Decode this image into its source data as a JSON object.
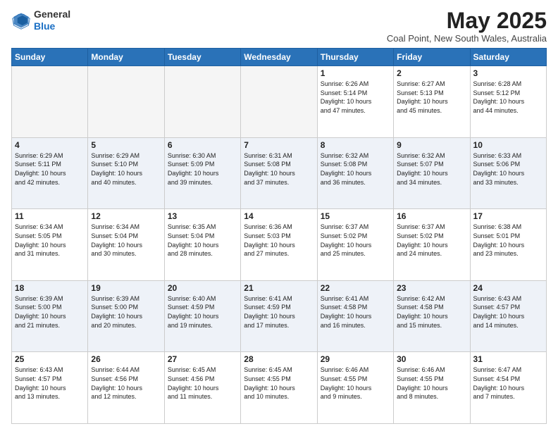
{
  "header": {
    "logo_general": "General",
    "logo_blue": "Blue",
    "month_title": "May 2025",
    "location": "Coal Point, New South Wales, Australia"
  },
  "weekdays": [
    "Sunday",
    "Monday",
    "Tuesday",
    "Wednesday",
    "Thursday",
    "Friday",
    "Saturday"
  ],
  "weeks": [
    [
      {
        "day": "",
        "info": ""
      },
      {
        "day": "",
        "info": ""
      },
      {
        "day": "",
        "info": ""
      },
      {
        "day": "",
        "info": ""
      },
      {
        "day": "1",
        "info": "Sunrise: 6:26 AM\nSunset: 5:14 PM\nDaylight: 10 hours\nand 47 minutes."
      },
      {
        "day": "2",
        "info": "Sunrise: 6:27 AM\nSunset: 5:13 PM\nDaylight: 10 hours\nand 45 minutes."
      },
      {
        "day": "3",
        "info": "Sunrise: 6:28 AM\nSunset: 5:12 PM\nDaylight: 10 hours\nand 44 minutes."
      }
    ],
    [
      {
        "day": "4",
        "info": "Sunrise: 6:29 AM\nSunset: 5:11 PM\nDaylight: 10 hours\nand 42 minutes."
      },
      {
        "day": "5",
        "info": "Sunrise: 6:29 AM\nSunset: 5:10 PM\nDaylight: 10 hours\nand 40 minutes."
      },
      {
        "day": "6",
        "info": "Sunrise: 6:30 AM\nSunset: 5:09 PM\nDaylight: 10 hours\nand 39 minutes."
      },
      {
        "day": "7",
        "info": "Sunrise: 6:31 AM\nSunset: 5:08 PM\nDaylight: 10 hours\nand 37 minutes."
      },
      {
        "day": "8",
        "info": "Sunrise: 6:32 AM\nSunset: 5:08 PM\nDaylight: 10 hours\nand 36 minutes."
      },
      {
        "day": "9",
        "info": "Sunrise: 6:32 AM\nSunset: 5:07 PM\nDaylight: 10 hours\nand 34 minutes."
      },
      {
        "day": "10",
        "info": "Sunrise: 6:33 AM\nSunset: 5:06 PM\nDaylight: 10 hours\nand 33 minutes."
      }
    ],
    [
      {
        "day": "11",
        "info": "Sunrise: 6:34 AM\nSunset: 5:05 PM\nDaylight: 10 hours\nand 31 minutes."
      },
      {
        "day": "12",
        "info": "Sunrise: 6:34 AM\nSunset: 5:04 PM\nDaylight: 10 hours\nand 30 minutes."
      },
      {
        "day": "13",
        "info": "Sunrise: 6:35 AM\nSunset: 5:04 PM\nDaylight: 10 hours\nand 28 minutes."
      },
      {
        "day": "14",
        "info": "Sunrise: 6:36 AM\nSunset: 5:03 PM\nDaylight: 10 hours\nand 27 minutes."
      },
      {
        "day": "15",
        "info": "Sunrise: 6:37 AM\nSunset: 5:02 PM\nDaylight: 10 hours\nand 25 minutes."
      },
      {
        "day": "16",
        "info": "Sunrise: 6:37 AM\nSunset: 5:02 PM\nDaylight: 10 hours\nand 24 minutes."
      },
      {
        "day": "17",
        "info": "Sunrise: 6:38 AM\nSunset: 5:01 PM\nDaylight: 10 hours\nand 23 minutes."
      }
    ],
    [
      {
        "day": "18",
        "info": "Sunrise: 6:39 AM\nSunset: 5:00 PM\nDaylight: 10 hours\nand 21 minutes."
      },
      {
        "day": "19",
        "info": "Sunrise: 6:39 AM\nSunset: 5:00 PM\nDaylight: 10 hours\nand 20 minutes."
      },
      {
        "day": "20",
        "info": "Sunrise: 6:40 AM\nSunset: 4:59 PM\nDaylight: 10 hours\nand 19 minutes."
      },
      {
        "day": "21",
        "info": "Sunrise: 6:41 AM\nSunset: 4:59 PM\nDaylight: 10 hours\nand 17 minutes."
      },
      {
        "day": "22",
        "info": "Sunrise: 6:41 AM\nSunset: 4:58 PM\nDaylight: 10 hours\nand 16 minutes."
      },
      {
        "day": "23",
        "info": "Sunrise: 6:42 AM\nSunset: 4:58 PM\nDaylight: 10 hours\nand 15 minutes."
      },
      {
        "day": "24",
        "info": "Sunrise: 6:43 AM\nSunset: 4:57 PM\nDaylight: 10 hours\nand 14 minutes."
      }
    ],
    [
      {
        "day": "25",
        "info": "Sunrise: 6:43 AM\nSunset: 4:57 PM\nDaylight: 10 hours\nand 13 minutes."
      },
      {
        "day": "26",
        "info": "Sunrise: 6:44 AM\nSunset: 4:56 PM\nDaylight: 10 hours\nand 12 minutes."
      },
      {
        "day": "27",
        "info": "Sunrise: 6:45 AM\nSunset: 4:56 PM\nDaylight: 10 hours\nand 11 minutes."
      },
      {
        "day": "28",
        "info": "Sunrise: 6:45 AM\nSunset: 4:55 PM\nDaylight: 10 hours\nand 10 minutes."
      },
      {
        "day": "29",
        "info": "Sunrise: 6:46 AM\nSunset: 4:55 PM\nDaylight: 10 hours\nand 9 minutes."
      },
      {
        "day": "30",
        "info": "Sunrise: 6:46 AM\nSunset: 4:55 PM\nDaylight: 10 hours\nand 8 minutes."
      },
      {
        "day": "31",
        "info": "Sunrise: 6:47 AM\nSunset: 4:54 PM\nDaylight: 10 hours\nand 7 minutes."
      }
    ]
  ]
}
